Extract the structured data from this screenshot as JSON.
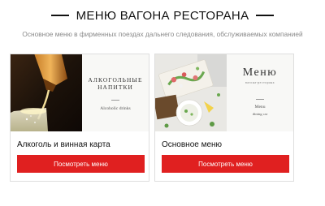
{
  "header": {
    "title": "МЕНЮ ВАГОНА РЕСТОРАНА",
    "subtitle": "Основное меню в фирменных поездах дальнего следования, обслуживаемых компанией"
  },
  "cards": [
    {
      "name": "Алкоголь и винная карта",
      "button_label": "Посмотреть меню",
      "panel_title_line1": "АЛКОГОЛЬНЫЕ",
      "panel_title_line2": "НАПИТКИ",
      "panel_caption": "Alcoholic drinks"
    },
    {
      "name": "Основное меню",
      "button_label": "Посмотреть меню",
      "panel_title": "Меню",
      "panel_tagline": "вагона-ресторана",
      "panel_caption_line1": "Menu",
      "panel_caption_line2": "dining car"
    }
  ],
  "colors": {
    "accent": "#e02020",
    "title": "#111111",
    "subtitle": "#8a8a8a",
    "card_border": "#dedede"
  }
}
